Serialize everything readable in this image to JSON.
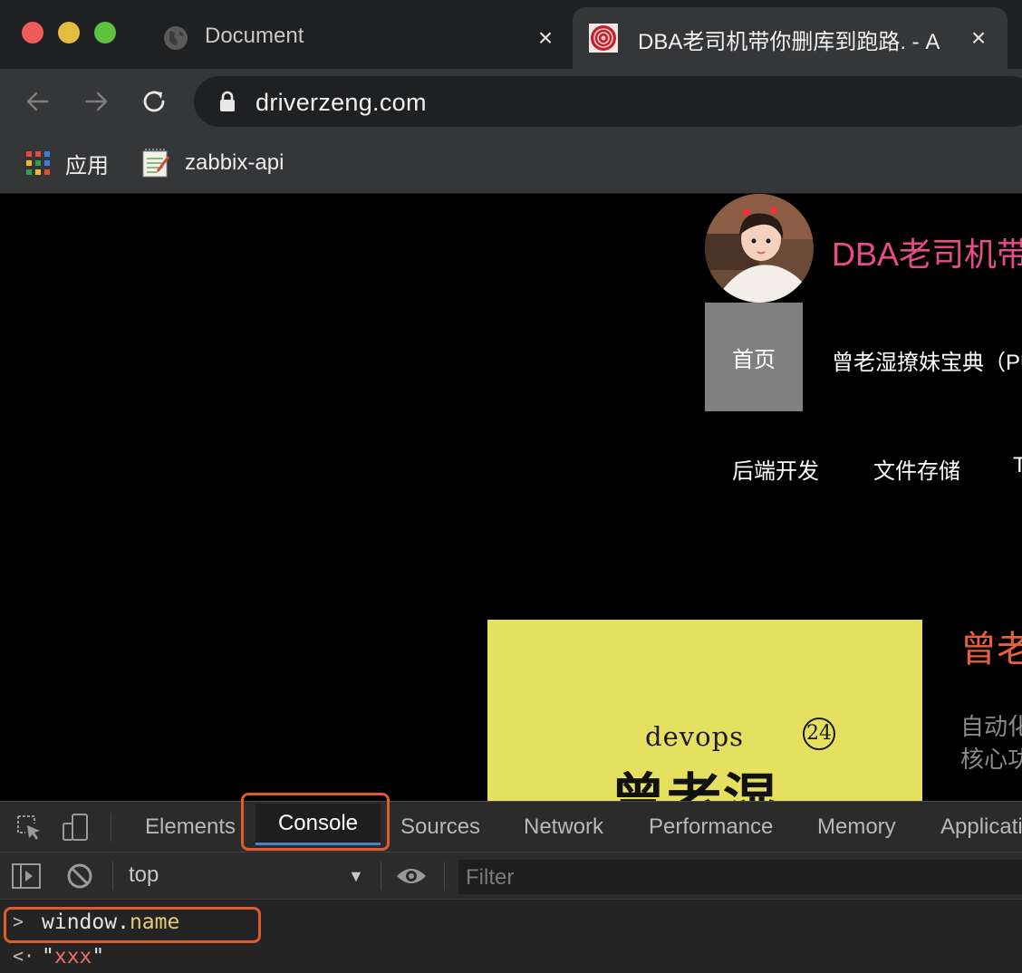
{
  "browser": {
    "tabs": [
      {
        "title": "Document",
        "active": false
      },
      {
        "title": "DBA老司机带你删库到跑路. - A",
        "active": true
      }
    ],
    "url": "driverzeng.com",
    "bookmarks": [
      {
        "label": "应用",
        "icon": "apps-grid-icon"
      },
      {
        "label": "zabbix-api",
        "icon": "notepad-icon"
      }
    ]
  },
  "page": {
    "site_title": "DBA老司机带",
    "nav_home": "首页",
    "nav_items": [
      "曾老湿撩妹宝典（PU",
      "后端开发",
      "文件存储",
      "T"
    ],
    "cover_en": "devops",
    "cover_number": "24",
    "cover_cn": "曾老湿",
    "post_title": "曾老",
    "post_excerpt_lines": [
      "自动化",
      "核心功"
    ]
  },
  "devtools": {
    "tabs": [
      "Elements",
      "Console",
      "Sources",
      "Network",
      "Performance",
      "Memory",
      "Applicati"
    ],
    "active_tab": "Console",
    "context": "top",
    "filter_placeholder": "Filter",
    "input_object": "window",
    "input_dot": ".",
    "input_property": "name",
    "output_value": "xxx"
  },
  "colors": {
    "accent_highlight": "#e05a2b",
    "site_title": "#e84a8c",
    "cover_bg": "#e6e060",
    "post_title": "#e8603c"
  }
}
